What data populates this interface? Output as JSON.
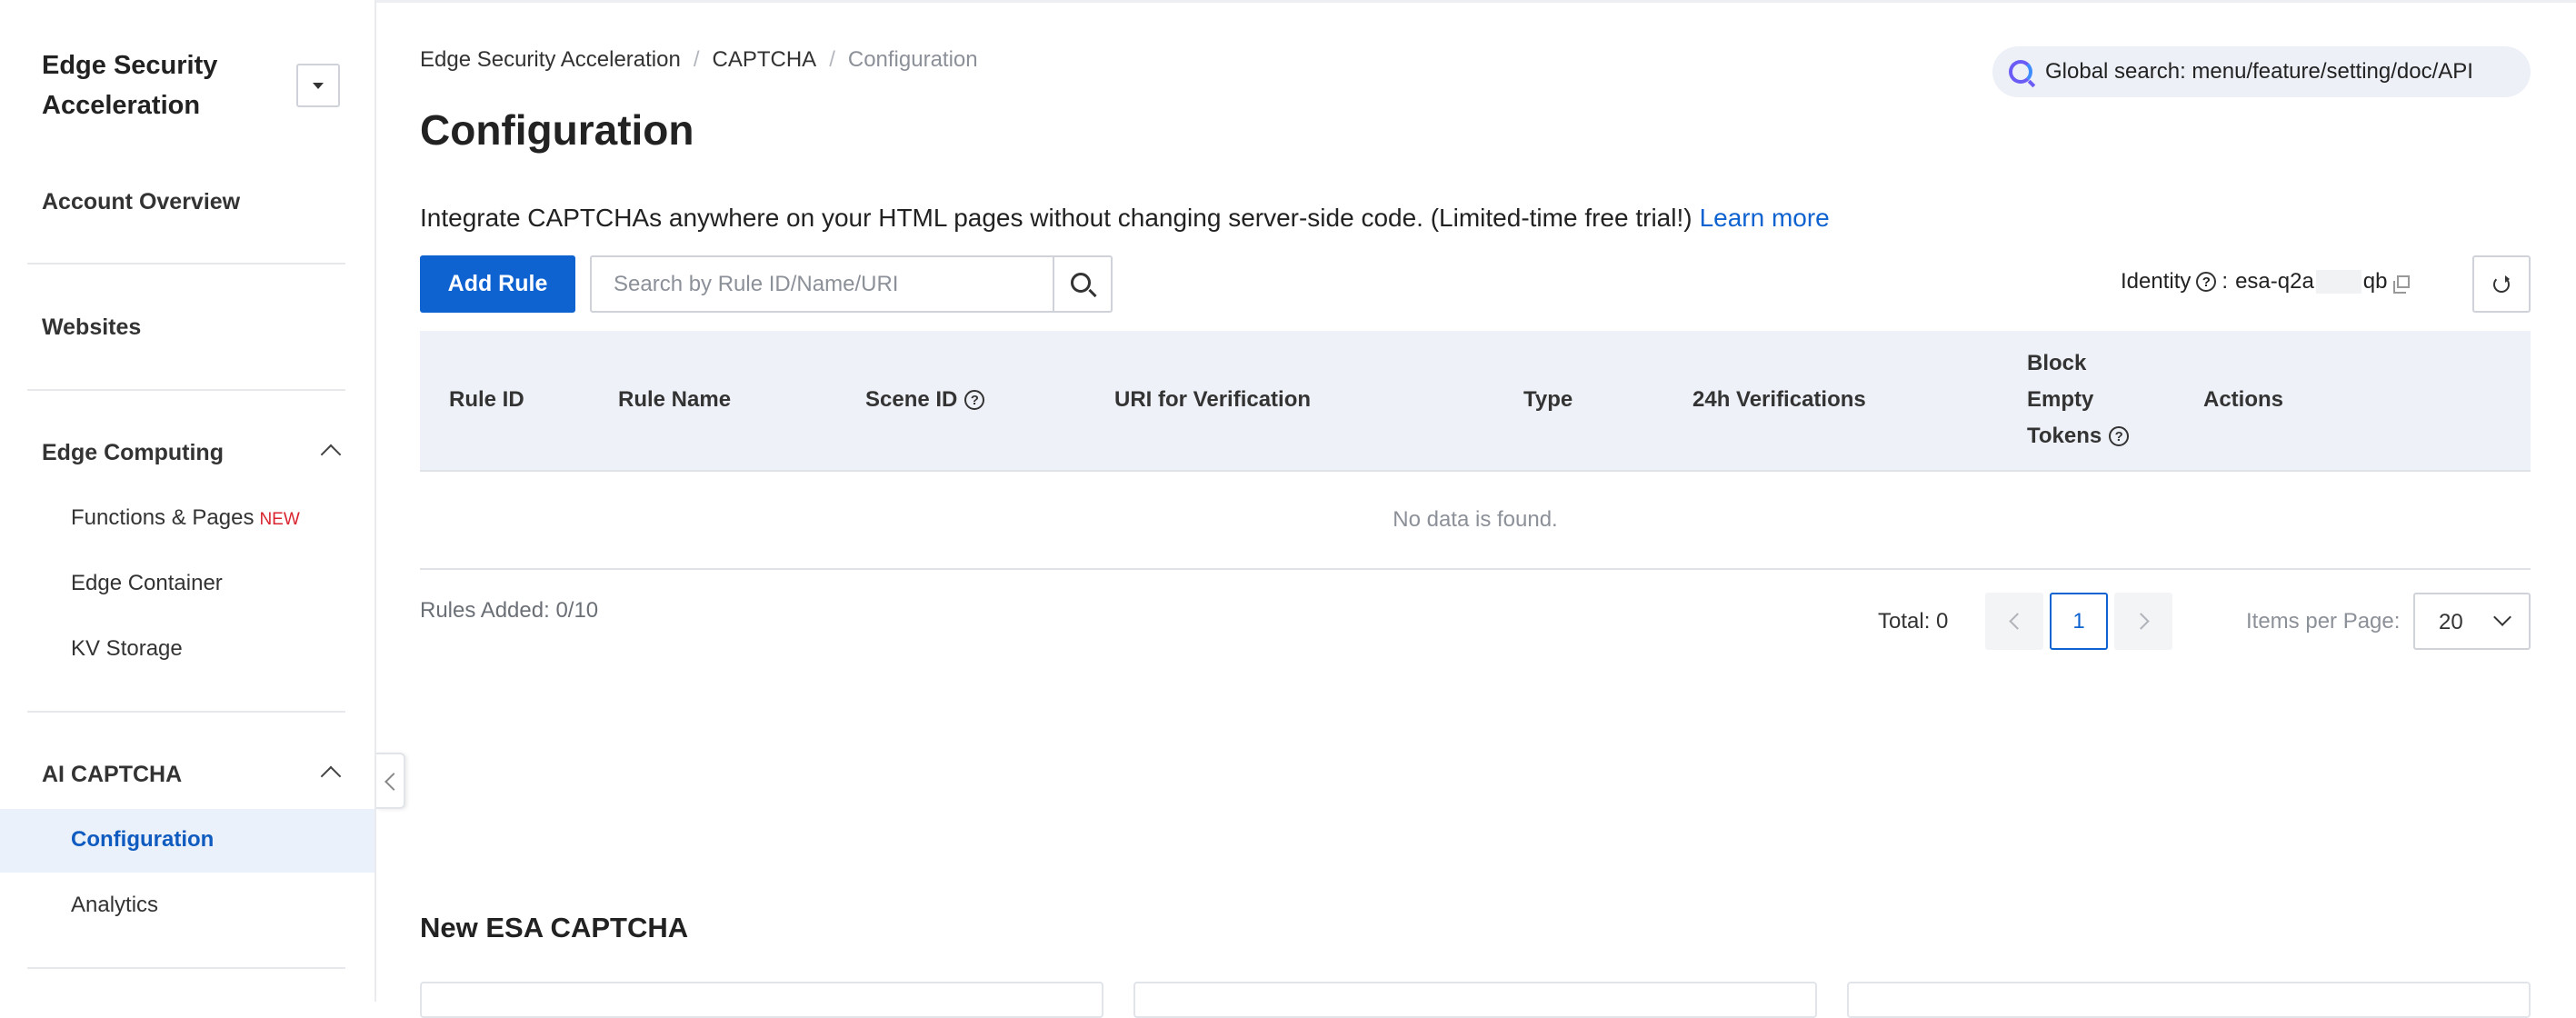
{
  "sidebar": {
    "title": "Edge Security Acceleration",
    "items": {
      "account_overview": "Account Overview",
      "websites": "Websites",
      "edge_computing": "Edge Computing",
      "ai_captcha": "AI CAPTCHA"
    },
    "edge_computing_items": {
      "functions_pages": "Functions & Pages",
      "functions_pages_badge": "NEW",
      "edge_container": "Edge Container",
      "kv_storage": "KV Storage"
    },
    "ai_captcha_items": {
      "configuration": "Configuration",
      "analytics": "Analytics"
    },
    "active_item": "Configuration"
  },
  "breadcrumb": {
    "items": [
      "Edge Security Acceleration",
      "CAPTCHA",
      "Configuration"
    ],
    "separator": "/"
  },
  "global_search": {
    "label": "Global search: menu/feature/setting/doc/API",
    "icon": "ai-search-icon"
  },
  "page": {
    "title": "Configuration",
    "intro": "Integrate CAPTCHAs anywhere on your HTML pages without changing server-side code. (Limited-time free trial!)",
    "learn_more": "Learn more"
  },
  "toolbar": {
    "add_rule": "Add Rule",
    "search_placeholder": "Search by Rule ID/Name/URI",
    "identity_label": "Identity",
    "identity_sep": ":",
    "identity_prefix": "esa-q2a",
    "identity_suffix": "qb"
  },
  "table": {
    "headers": [
      "Rule ID",
      "Rule Name",
      "Scene ID",
      "URI for Verification",
      "Type",
      "24h Verifications",
      "Block Empty Tokens",
      "Actions"
    ],
    "header_lines": {
      "block_empty_tokens": [
        "Block",
        "Empty",
        "Tokens"
      ]
    },
    "empty_text": "No data is found."
  },
  "footer": {
    "rules_added": "Rules Added: 0/10",
    "total": "Total: 0",
    "current_page": "1",
    "items_per_page_label": "Items per Page:",
    "items_per_page_value": "20"
  },
  "section": {
    "title": "New ESA CAPTCHA"
  },
  "colors": {
    "primary": "#0f63d1",
    "active_bg": "#ebf1fb",
    "badge_red": "#d9242f",
    "table_header_bg": "#eef1f7"
  }
}
